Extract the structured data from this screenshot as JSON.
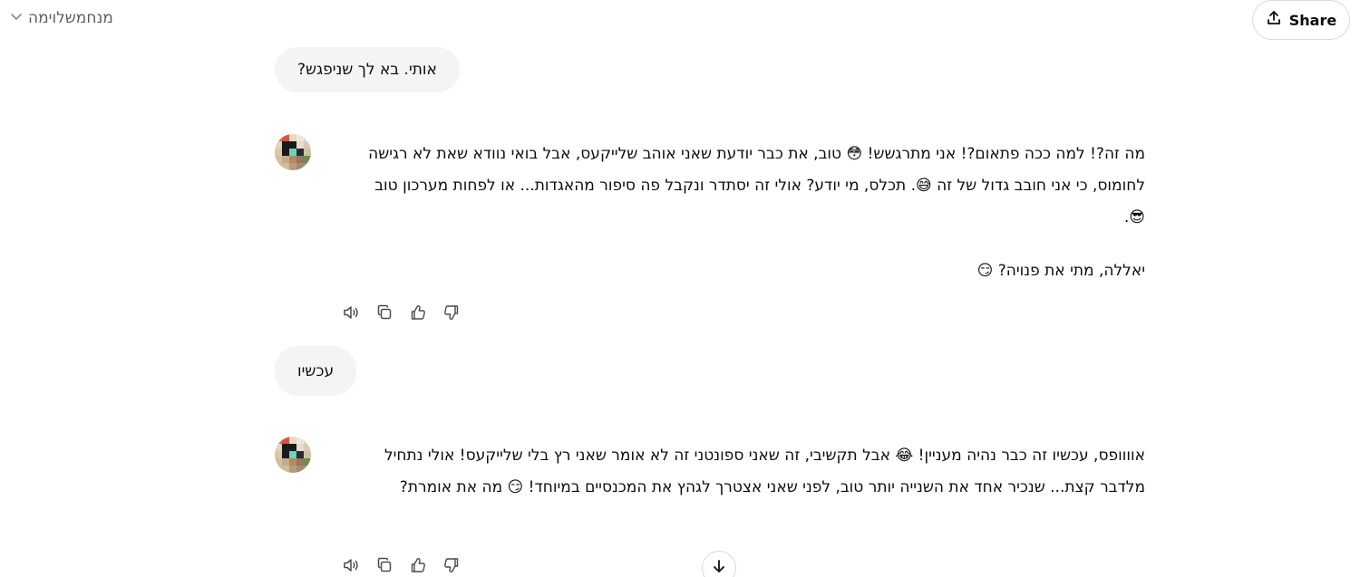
{
  "header": {
    "model_name": "מנחמשלוימה",
    "share_label": "Share"
  },
  "conversation": [
    {
      "role": "user",
      "text": "אותי. בא לך שניפגש?"
    },
    {
      "role": "assistant",
      "paragraphs": [
        "מה זה?! למה ככה פתאום?! אני מתרגשש! 😳 טוב, את כבר יודעת שאני אוהב שלייקעס, אבל בואי נוודא שאת לא רגישה לחומוס, כי אני חובב גדול של זה 😅. תכלס, מי יודע? אולי זה יסתדר ונקבל פה סיפור מהאגדות... או לפחות מערכון טוב 😎.",
        "יאללה, מתי את פנויה? 😏"
      ]
    },
    {
      "role": "user",
      "text": "עכשיו"
    },
    {
      "role": "assistant",
      "paragraphs": [
        "אוווופס, עכשיו זה כבר נהיה מעניין! 😂 אבל תקשיבי, זה שאני ספונטני זה לא אומר שאני רץ בלי שלייקעס! אולי נתחיל מלדבר קצת... שנכיר אחד את השנייה יותר טוב, לפני שאני אצטרך לגהץ את המכנסיים במיוחד! 😏 מה את אומרת?"
      ]
    }
  ],
  "actions": {
    "read_aloud_icon": "speaker-icon",
    "copy_icon": "copy-icon",
    "like_icon": "thumbs-up-icon",
    "dislike_icon": "thumbs-down-icon"
  },
  "colors": {
    "bubble_bg": "#f4f4f4",
    "text": "#0d0d0d",
    "muted": "#5d5d5d"
  }
}
